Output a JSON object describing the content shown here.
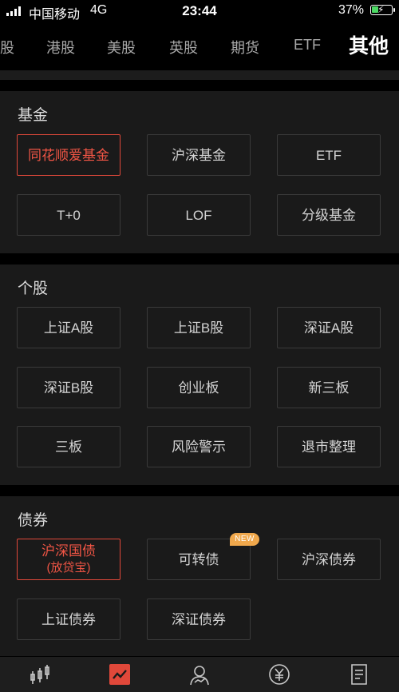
{
  "status_bar": {
    "carrier": "中国移动",
    "network": "4G",
    "time": "23:44",
    "battery_percent": "37%",
    "battery_level": 0.37
  },
  "tabs": [
    {
      "label": "股"
    },
    {
      "label": "港股"
    },
    {
      "label": "美股"
    },
    {
      "label": "英股"
    },
    {
      "label": "期货"
    },
    {
      "label": "ETF"
    },
    {
      "label": "其他",
      "active": true
    }
  ],
  "sections": {
    "fund": {
      "title": "基金",
      "items": [
        "同花顺爱基金",
        "沪深基金",
        "ETF",
        "T+0",
        "LOF",
        "分级基金"
      ]
    },
    "stock": {
      "title": "个股",
      "items": [
        "上证A股",
        "上证B股",
        "深证A股",
        "深证B股",
        "创业板",
        "新三板",
        "三板",
        "风险警示",
        "退市整理"
      ]
    },
    "bond": {
      "title": "债券",
      "items": [
        {
          "line1": "沪深国债",
          "line2": "(放贷宝)"
        },
        {
          "line1": "可转债",
          "badge": "NEW"
        },
        {
          "line1": "沪深债券"
        },
        {
          "line1": "上证债券"
        },
        {
          "line1": "深证债券"
        }
      ]
    }
  },
  "colors": {
    "accent": "#f05545",
    "badge": "#f0a84c",
    "background": "#000000",
    "panel": "#1a1a1a"
  },
  "bottom_nav": [
    {
      "icon": "candlestick-chart-icon"
    },
    {
      "icon": "trend-chart-icon",
      "active": true
    },
    {
      "icon": "user-profile-icon"
    },
    {
      "icon": "yen-coin-icon"
    },
    {
      "icon": "document-icon"
    }
  ]
}
